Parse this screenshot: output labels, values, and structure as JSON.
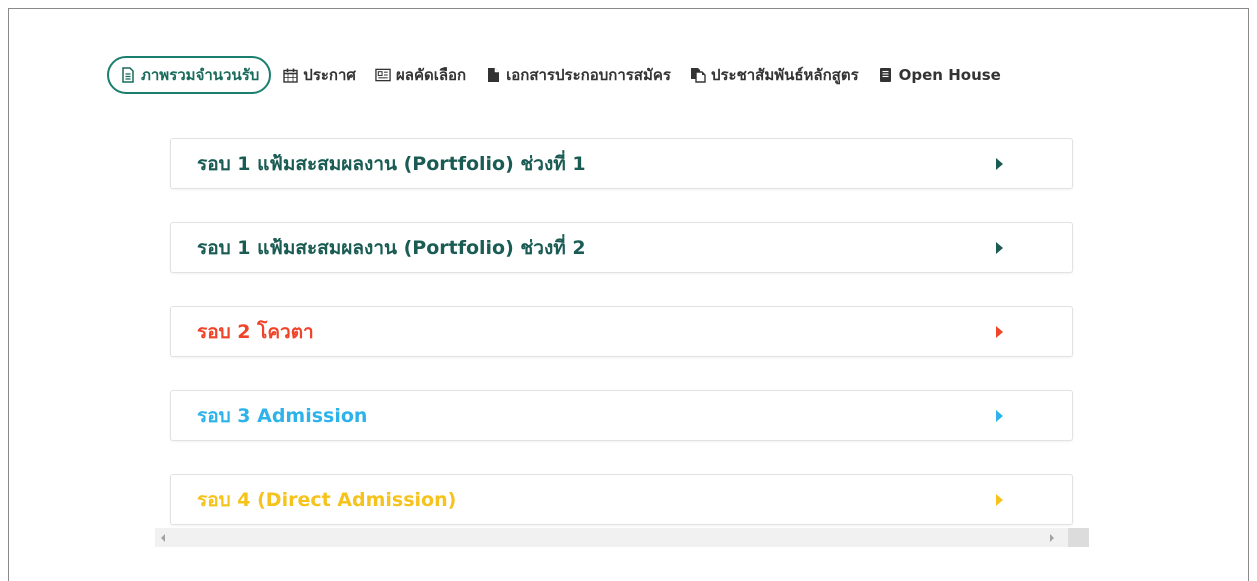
{
  "nav": {
    "items": [
      {
        "label": "ภาพรวมจำนวนรับ",
        "icon": "document-text-icon",
        "active": true
      },
      {
        "label": "ประกาศ",
        "icon": "calendar-icon",
        "active": false
      },
      {
        "label": "ผลคัดเลือก",
        "icon": "newspaper-icon",
        "active": false
      },
      {
        "label": "เอกสารประกอบการสมัคร",
        "icon": "file-icon",
        "active": false
      },
      {
        "label": "ประชาสัมพันธ์หลักสูตร",
        "icon": "copy-icon",
        "active": false
      },
      {
        "label": "Open House",
        "icon": "book-icon",
        "active": false
      }
    ]
  },
  "rounds": [
    {
      "label": "รอบ 1 แฟ้มสะสมผลงาน (Portfolio) ช่วงที่ 1",
      "color": "#1a5c54"
    },
    {
      "label": "รอบ 1 แฟ้มสะสมผลงาน (Portfolio) ช่วงที่ 2",
      "color": "#1a5c54"
    },
    {
      "label": "รอบ 2 โควตา",
      "color": "#f0442a"
    },
    {
      "label": "รอบ 3 Admission",
      "color": "#2db3ea"
    },
    {
      "label": "รอบ 4 (Direct Admission)",
      "color": "#f6c31c"
    }
  ],
  "theme": {
    "accent": "#1a7f6e",
    "nav_text": "#333333"
  }
}
